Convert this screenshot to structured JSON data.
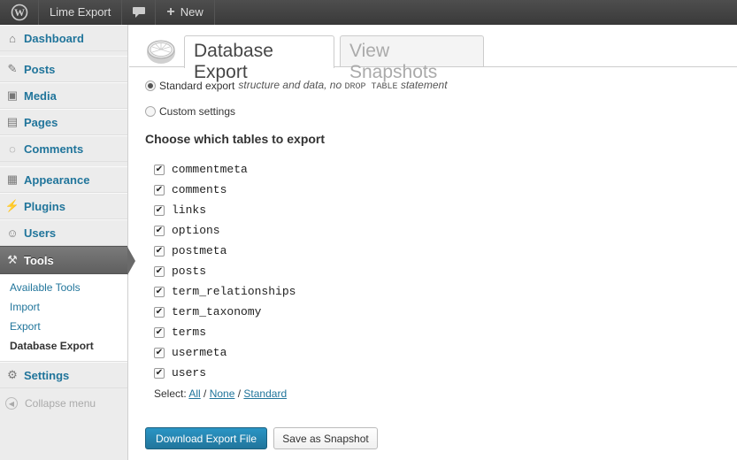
{
  "adminbar": {
    "site_name": "Lime Export",
    "new_label": "New"
  },
  "sidebar": {
    "items": [
      {
        "label": "Dashboard",
        "icon": "dashboard-icon"
      },
      {
        "label": "Posts",
        "icon": "pin-icon"
      },
      {
        "label": "Media",
        "icon": "media-icon"
      },
      {
        "label": "Pages",
        "icon": "pages-icon"
      },
      {
        "label": "Comments",
        "icon": "comment-icon"
      },
      {
        "label": "Appearance",
        "icon": "appearance-icon"
      },
      {
        "label": "Plugins",
        "icon": "plugin-icon"
      },
      {
        "label": "Users",
        "icon": "users-icon"
      },
      {
        "label": "Tools",
        "icon": "tools-icon"
      },
      {
        "label": "Settings",
        "icon": "settings-icon"
      }
    ],
    "tools_submenu": [
      "Available Tools",
      "Import",
      "Export",
      "Database Export"
    ],
    "collapse_label": "Collapse menu"
  },
  "tabs": {
    "active": "Database Export",
    "inactive": "View Snapshots"
  },
  "options": {
    "standard_label": "Standard export",
    "standard_desc_pre": "structure and data, no",
    "standard_desc_code": "DROP TABLE",
    "standard_desc_post": "statement",
    "custom_label": "Custom settings",
    "selected": "standard"
  },
  "section_title": "Choose which tables to export",
  "tables": [
    {
      "name": "commentmeta",
      "checked": true
    },
    {
      "name": "comments",
      "checked": true
    },
    {
      "name": "links",
      "checked": true
    },
    {
      "name": "options",
      "checked": true
    },
    {
      "name": "postmeta",
      "checked": true
    },
    {
      "name": "posts",
      "checked": true
    },
    {
      "name": "term_relationships",
      "checked": true
    },
    {
      "name": "term_taxonomy",
      "checked": true
    },
    {
      "name": "terms",
      "checked": true
    },
    {
      "name": "usermeta",
      "checked": true
    },
    {
      "name": "users",
      "checked": true
    }
  ],
  "select": {
    "label": "Select:",
    "all": "All",
    "none": "None",
    "standard": "Standard"
  },
  "buttons": {
    "download": "Download Export File",
    "snapshot": "Save as Snapshot"
  },
  "colors": {
    "link": "#21759b",
    "primary_button": "#21759b",
    "adminbar": "#464646"
  }
}
